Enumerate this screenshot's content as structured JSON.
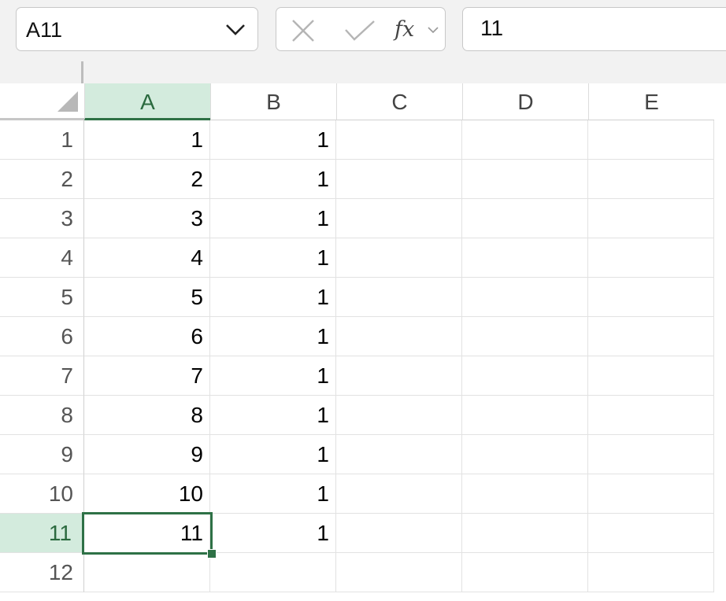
{
  "formula_bar": {
    "name_box": "A11",
    "fx_label": "fx",
    "formula_value": "11"
  },
  "columns": [
    "A",
    "B",
    "C",
    "D",
    "E"
  ],
  "selected_column": "A",
  "rows": [
    {
      "num": "1",
      "a": "1",
      "b": "1"
    },
    {
      "num": "2",
      "a": "2",
      "b": "1"
    },
    {
      "num": "3",
      "a": "3",
      "b": "1"
    },
    {
      "num": "4",
      "a": "4",
      "b": "1"
    },
    {
      "num": "5",
      "a": "5",
      "b": "1"
    },
    {
      "num": "6",
      "a": "6",
      "b": "1"
    },
    {
      "num": "7",
      "a": "7",
      "b": "1"
    },
    {
      "num": "8",
      "a": "8",
      "b": "1"
    },
    {
      "num": "9",
      "a": "9",
      "b": "1"
    },
    {
      "num": "10",
      "a": "10",
      "b": "1"
    },
    {
      "num": "11",
      "a": "11",
      "b": "1"
    },
    {
      "num": "12",
      "a": "",
      "b": ""
    }
  ],
  "selected_row": "11",
  "active_cell": "A11",
  "colors": {
    "selection_green": "#2e7146",
    "header_highlight": "#d3ebdd"
  }
}
